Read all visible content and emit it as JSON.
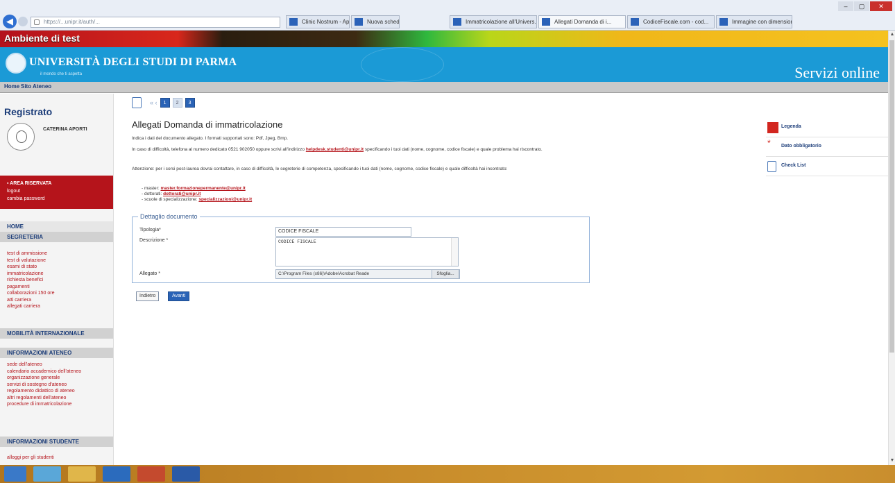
{
  "browser": {
    "address": "https://...unipr.it/auth/...",
    "tabs": [
      "Clinic Nostrum - Applicat...",
      "Nuova scheda",
      "Immatricolazione all'Univers...",
      "Allegati Domanda di i...",
      "CodiceFiscale.com - cod...",
      "Immagine con dimensione..."
    ],
    "back_icon": "back-arrow-icon",
    "min_label": "–",
    "max_label": "▢",
    "close_label": "✕"
  },
  "test_bar": {
    "label": "Ambiente di test"
  },
  "header": {
    "university": "UNIVERSITÀ DEGLI STUDI DI PARMA",
    "subtitle": "il mondo che ti aspetta",
    "servizi": "Servizi online"
  },
  "navbar": {
    "home": "Home",
    "ateneo": "Sito Ateneo"
  },
  "sidebar": {
    "title": "Registrato",
    "user": "CATERINA APORTI",
    "area": {
      "title": "▪ AREA RISERVATA",
      "logout": "logout",
      "password": "cambia password"
    },
    "home": "HOME",
    "segreteria": "SEGRETERIA",
    "segreteria_items": [
      "test di ammissione",
      "test di valutazione",
      "esami di stato",
      "immatricolazione",
      "richiesta benefici",
      "pagamenti",
      "collaborazioni 150 ore",
      "atti carriera",
      "allegati carriera"
    ],
    "mobilita": "MOBILITÀ INTERNAZIONALE",
    "info_ateneo": "INFORMAZIONI ATENEO",
    "info_items": [
      "sede dell'ateneo",
      "calendario accademico dell'ateneo",
      "organizzazione generale",
      "servizi di sostegno d'ateneo",
      "regolamento didattico di ateneo",
      "altri regolamenti dell'ateneo",
      "procedure di immatricolazione"
    ],
    "info_studente": "INFORMAZIONI STUDENTE",
    "studente_items": [
      "alloggi per gli studenti"
    ]
  },
  "main": {
    "steps": [
      "1",
      "2",
      "3"
    ],
    "step_dots": "«  ‹",
    "title": "Allegati Domanda di immatricolazione",
    "para1": "Indica i dati del documento allegato. I formati supportati sono: Pdf, Jpeg, Bmp.",
    "para2_pre": "In caso di difficoltà, telefona al numero dedicato 0521 902050 oppure scrivi all'indirizzo ",
    "para2_email": "helpdesk.studenti@unipr.it",
    "para2_post": " specificando i tuoi dati (nome, cognome, codice fiscale) e quale problema hai riscontrato.",
    "para3": "Attenzione: per i corsi post-laurea dovrai contattare, in caso di difficoltà, le segreterie di competenza, specificando i tuoi dati (nome, cognome, codice fiscale) e quale difficoltà hai incontrato:",
    "bullets": [
      {
        "pre": "- master: ",
        "email": "master.formazionepermanente@unipr.it"
      },
      {
        "pre": "- dottorati: ",
        "email": "dottorati@unipr.it"
      },
      {
        "pre": "- scuole di specializzazione: ",
        "email": "specializzazioni@unipr.it"
      }
    ],
    "form": {
      "legend": "Dettaglio documento",
      "tipologia_label": "Tipologia*",
      "tipologia_value": "CODICE FISCALE",
      "descrizione_label": "Descrizione *",
      "descrizione_value": "CODICE FISCALE",
      "allegato_label": "Allegato *",
      "allegato_value": "C:\\Program Files (x86)\\Adobe\\Acrobat Reade",
      "browse": "Sfoglia..."
    },
    "indietro": "Indietro",
    "avanti": "Avanti"
  },
  "right_panel": {
    "legenda": "Legenda",
    "obbligatorio": "Dato obbligatorio",
    "checklist": "Check List"
  },
  "colors": {
    "header_blue": "#1b9ad6",
    "accent_red": "#b5141b",
    "nav_blue": "#1c3d79"
  }
}
